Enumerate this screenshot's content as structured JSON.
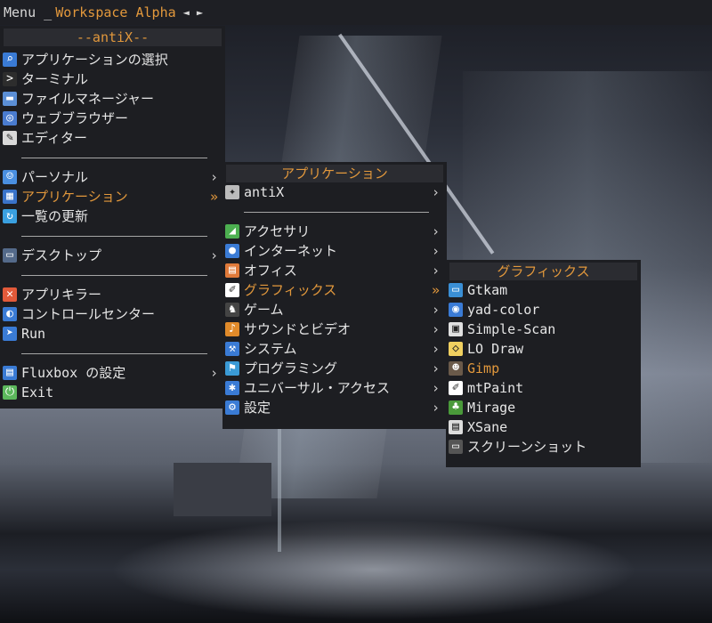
{
  "taskbar": {
    "menu": "Menu _",
    "workspace": "Workspace Alpha",
    "prev": "◄",
    "next": "►"
  },
  "menu_main": {
    "title": "--antiX--",
    "items": [
      {
        "label": "アプリケーションの選択",
        "icon": "search-icon",
        "color": "#3a7bd5"
      },
      {
        "label": "ターミナル",
        "icon": "terminal-icon",
        "color": "#2d2d2d"
      },
      {
        "label": "ファイルマネージャー",
        "icon": "folder-icon",
        "color": "#5b8fd6"
      },
      {
        "label": "ウェブブラウザー",
        "icon": "browser-icon",
        "color": "#4a7cd0"
      },
      {
        "label": "エディター",
        "icon": "editor-icon",
        "color": "#d9d9d9"
      },
      {
        "label": "パーソナル",
        "icon": "person-icon",
        "color": "#4a8fe0",
        "submenu": "›"
      },
      {
        "label": "アプリケーション",
        "icon": "apps-icon",
        "color": "#3a73c9",
        "submenu": "»",
        "active": true
      },
      {
        "label": "一覧の更新",
        "icon": "refresh-icon",
        "color": "#3aa0e0"
      },
      {
        "label": "デスクトップ",
        "icon": "desktop-icon",
        "color": "#546a8a",
        "submenu": "›"
      },
      {
        "label": "アプリキラー",
        "icon": "kill-icon",
        "color": "#e25a3a"
      },
      {
        "label": "コントロールセンター",
        "icon": "control-center-icon",
        "color": "#3a7bd5"
      },
      {
        "label": "Run",
        "icon": "run-icon",
        "color": "#3a7bd5"
      },
      {
        "label": "Fluxbox の設定",
        "icon": "fluxbox-settings-icon",
        "color": "#3a7bd5",
        "submenu": "›"
      },
      {
        "label": "Exit",
        "icon": "power-icon",
        "color": "#5cb85c"
      }
    ]
  },
  "menu_apps": {
    "title": "アプリケーション",
    "items": [
      {
        "label": "antiX",
        "icon": "antix-icon",
        "color": "#bbbbbb",
        "submenu": "›"
      },
      {
        "label": "アクセサリ",
        "icon": "accessories-icon",
        "color": "#4caf50",
        "submenu": "›"
      },
      {
        "label": "インターネット",
        "icon": "internet-icon",
        "color": "#3a7bd5",
        "submenu": "›"
      },
      {
        "label": "オフィス",
        "icon": "office-icon",
        "color": "#e07a3a",
        "submenu": "›"
      },
      {
        "label": "グラフィックス",
        "icon": "graphics-icon",
        "color": "#ffffff",
        "submenu": "»",
        "active": true
      },
      {
        "label": "ゲーム",
        "icon": "game-icon",
        "color": "#444444",
        "submenu": "›"
      },
      {
        "label": "サウンドとビデオ",
        "icon": "sound-video-icon",
        "color": "#e08a2a",
        "submenu": "›"
      },
      {
        "label": "システム",
        "icon": "system-icon",
        "color": "#3a7bd5",
        "submenu": "›"
      },
      {
        "label": "プログラミング",
        "icon": "programming-icon",
        "color": "#3a9ad5",
        "submenu": "›"
      },
      {
        "label": "ユニバーサル・アクセス",
        "icon": "accessibility-icon",
        "color": "#3a7bd5",
        "submenu": "›"
      },
      {
        "label": "設定",
        "icon": "settings-icon",
        "color": "#3a7bd5",
        "submenu": "›"
      }
    ]
  },
  "menu_graphics": {
    "title": "グラフィックス",
    "items": [
      {
        "label": "Gtkam",
        "icon": "gtkam-icon",
        "color": "#3a8fd5"
      },
      {
        "label": "yad-color",
        "icon": "color-picker-icon",
        "color": "#3a7bd5"
      },
      {
        "label": "Simple-Scan",
        "icon": "scanner-icon",
        "color": "#e0e0e0"
      },
      {
        "label": "LO Draw",
        "icon": "lo-draw-icon",
        "color": "#f0d060"
      },
      {
        "label": "Gimp",
        "icon": "gimp-icon",
        "color": "#6a5a4a",
        "active": true
      },
      {
        "label": "mtPaint",
        "icon": "mtpaint-icon",
        "color": "#ffffff"
      },
      {
        "label": "Mirage",
        "icon": "palm-tree-icon",
        "color": "#4a9a3a"
      },
      {
        "label": "XSane",
        "icon": "xsane-icon",
        "color": "#dddddd"
      },
      {
        "label": "スクリーンショット",
        "icon": "screenshot-icon",
        "color": "#555555"
      }
    ]
  }
}
